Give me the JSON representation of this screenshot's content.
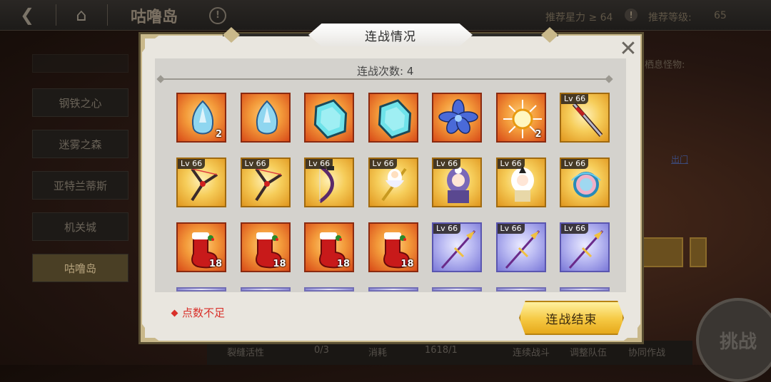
{
  "topbar": {
    "title": "咕噜岛",
    "rec_power": "推荐星力 ≥ 64",
    "rec_level_label": "推荐等级:",
    "rec_level_value": "65"
  },
  "sidebar": {
    "items": [
      {
        "label": "钢铁之心",
        "active": false
      },
      {
        "label": "迷雾之森",
        "active": false
      },
      {
        "label": "亚特兰蒂斯",
        "active": false
      },
      {
        "label": "机关城",
        "active": false
      },
      {
        "label": "咕噜岛",
        "active": true
      }
    ]
  },
  "background": {
    "monster_text": "栖息怪物:",
    "link_text": "出门"
  },
  "bottom_bar": {
    "rift": "裂缝活性",
    "rift_count": "0/3",
    "cost": "消耗",
    "cost_value": "1618/1",
    "continuous": "连续战斗",
    "adjust_team": "调整队伍",
    "assist": "协同作战",
    "challenge": "挑战"
  },
  "dialog": {
    "title": "连战情况",
    "battle_count": "连战次数: 4",
    "warning": "点数不足",
    "end_button": "连战结束"
  },
  "items": [
    {
      "kind": "crystal",
      "bg": "red",
      "lv": "",
      "count": "2"
    },
    {
      "kind": "crystal",
      "bg": "red",
      "lv": "",
      "count": ""
    },
    {
      "kind": "cyan-gem",
      "bg": "red",
      "lv": "",
      "count": ""
    },
    {
      "kind": "cyan-gem",
      "bg": "red",
      "lv": "",
      "count": ""
    },
    {
      "kind": "blue-flower",
      "bg": "red",
      "lv": "",
      "count": ""
    },
    {
      "kind": "sun-orb",
      "bg": "red",
      "lv": "",
      "count": "2"
    },
    {
      "kind": "sword",
      "bg": "gold",
      "lv": "Lv 66",
      "count": ""
    },
    {
      "kind": "slingshot",
      "bg": "gold",
      "lv": "Lv 66",
      "count": ""
    },
    {
      "kind": "slingshot",
      "bg": "gold",
      "lv": "Lv 66",
      "count": ""
    },
    {
      "kind": "bow",
      "bg": "gold",
      "lv": "Lv 66",
      "count": ""
    },
    {
      "kind": "staff-character",
      "bg": "gold",
      "lv": "Lv 66",
      "count": ""
    },
    {
      "kind": "doll-purple",
      "bg": "gold",
      "lv": "Lv 66",
      "count": ""
    },
    {
      "kind": "doll-white",
      "bg": "gold",
      "lv": "Lv 66",
      "count": ""
    },
    {
      "kind": "mirror",
      "bg": "gold",
      "lv": "Lv 66",
      "count": ""
    },
    {
      "kind": "stocking",
      "bg": "red",
      "lv": "",
      "count": "18"
    },
    {
      "kind": "stocking",
      "bg": "red",
      "lv": "",
      "count": "18"
    },
    {
      "kind": "stocking",
      "bg": "red",
      "lv": "",
      "count": "18"
    },
    {
      "kind": "stocking",
      "bg": "red",
      "lv": "",
      "count": "18"
    },
    {
      "kind": "spear",
      "bg": "purple",
      "lv": "Lv 66",
      "count": ""
    },
    {
      "kind": "spear",
      "bg": "purple",
      "lv": "Lv 66",
      "count": ""
    },
    {
      "kind": "spear",
      "bg": "purple",
      "lv": "Lv 66",
      "count": ""
    }
  ],
  "colors": {
    "warning": "#d9302a",
    "button_gold": "#f5c842",
    "dialog_bg": "#e9e6df"
  }
}
